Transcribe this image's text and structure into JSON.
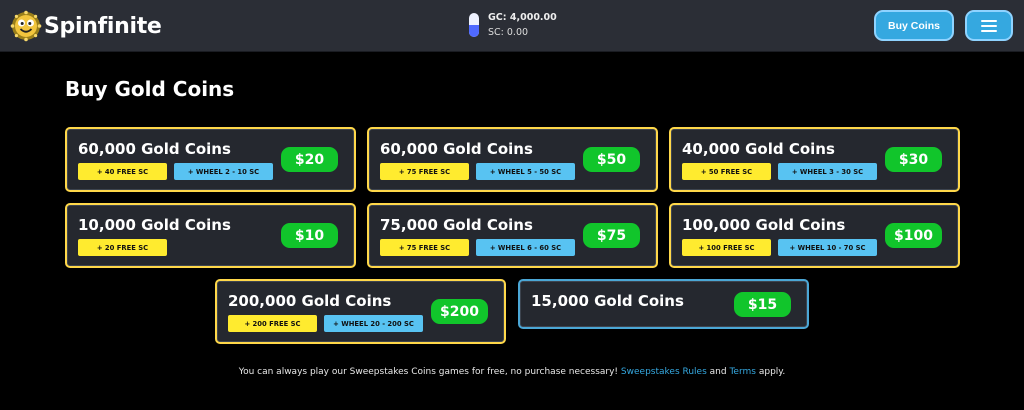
{
  "header": {
    "brand": "Spinfinite",
    "gc_balance": "GC: 4,000.00",
    "sc_balance": "SC: 0.00",
    "buy_button": "Buy Coins"
  },
  "main": {
    "title": "Buy Gold Coins",
    "packages": [
      {
        "amount": "60,000 Gold Coins",
        "free_sc": "+ 40 FREE SC",
        "wheel": "+ WHEEL 2 - 10 SC",
        "price": "$20"
      },
      {
        "amount": "60,000 Gold Coins",
        "free_sc": "+ 75 FREE SC",
        "wheel": "+ WHEEL 5 - 50 SC",
        "price": "$50"
      },
      {
        "amount": "40,000 Gold Coins",
        "free_sc": "+ 50 FREE SC",
        "wheel": "+ WHEEL 3 - 30 SC",
        "price": "$30"
      },
      {
        "amount": "10,000 Gold Coins",
        "free_sc": "+ 20 FREE SC",
        "wheel": "",
        "price": "$10"
      },
      {
        "amount": "75,000 Gold Coins",
        "free_sc": "+ 75 FREE SC",
        "wheel": "+ WHEEL 6 - 60 SC",
        "price": "$75"
      },
      {
        "amount": "100,000 Gold Coins",
        "free_sc": "+ 100 FREE SC",
        "wheel": "+ WHEEL 10 - 70 SC",
        "price": "$100"
      },
      {
        "amount": "200,000 Gold Coins",
        "free_sc": "+ 200 FREE SC",
        "wheel": "+ WHEEL 20 - 200 SC",
        "price": "$200"
      },
      {
        "amount": "15,000 Gold Coins",
        "free_sc": "",
        "wheel": "",
        "price": "$15"
      }
    ]
  },
  "footer": {
    "note_prefix": "You can always play our Sweepstakes Coins games for free, no purchase necessary!",
    "rules_link": "Sweepstakes Rules",
    "and": "and",
    "terms_link": "Terms",
    "suffix": "apply."
  },
  "colors": {
    "accent": "#35a8e0",
    "price_green": "#11c52b",
    "gold": "#ffd84a",
    "sc_tag": "#ffeb2f",
    "wheel_tag": "#58c3f2"
  },
  "icons": {
    "brand": "coin-smiley-icon",
    "wallet": "wallet-capsule-icon",
    "menu": "hamburger-icon"
  }
}
